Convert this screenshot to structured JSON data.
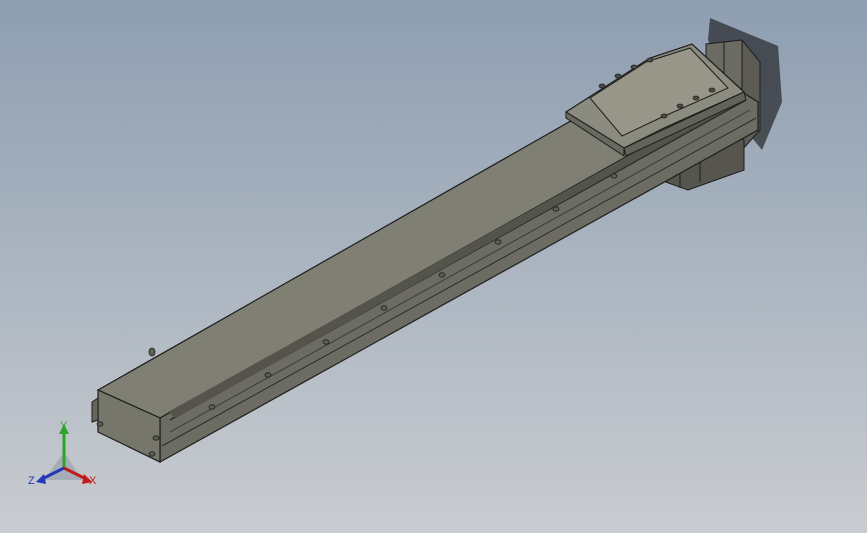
{
  "viewport": {
    "background_top": "#8e9eb1",
    "background_bottom": "#c9ccd0"
  },
  "model": {
    "part_color": "#7f7e73",
    "edge_color": "#1d1d1d"
  },
  "triad": {
    "x_label": "X",
    "y_label": "Y",
    "z_label": "Z",
    "x_color": "#c21a1a",
    "y_color": "#2aa52a",
    "z_color": "#2438b8"
  }
}
